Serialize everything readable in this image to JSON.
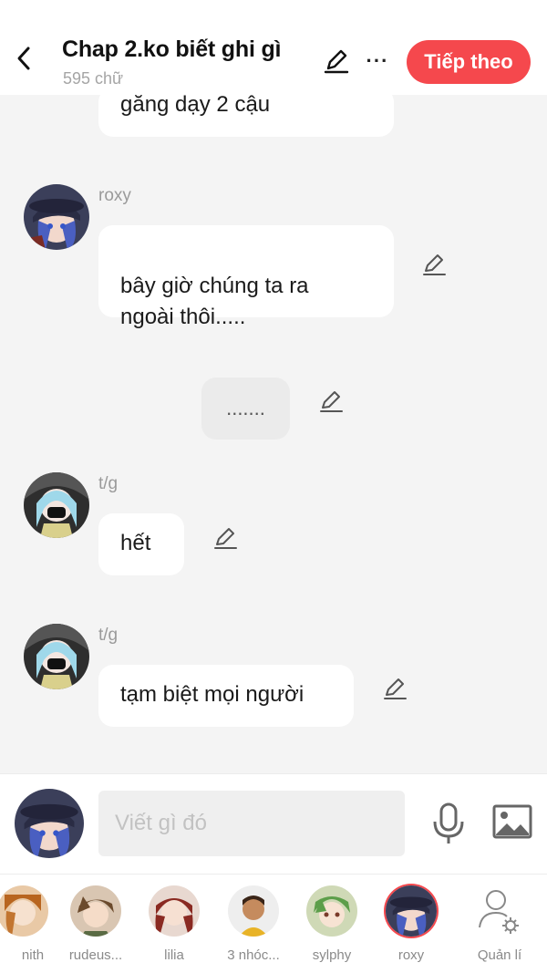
{
  "header": {
    "title": "Chap 2.ko biết ghi gì",
    "word_count": "595 chữ",
    "next_label": "Tiếp theo",
    "more_label": "···"
  },
  "messages": [
    {
      "type": "bubble",
      "text": "gắng dạy 2 cậu"
    },
    {
      "type": "character",
      "name": "roxy",
      "text": "bây giờ chúng ta ra\nngoài thôi....."
    },
    {
      "type": "narration",
      "text": "......."
    },
    {
      "type": "character",
      "name": "t/g",
      "text": "hết"
    },
    {
      "type": "character",
      "name": "t/g",
      "text": "tạm biệt mọi người"
    }
  ],
  "input": {
    "placeholder": "Viết gì đó"
  },
  "characters": [
    {
      "name": "nith"
    },
    {
      "name": "rudeus..."
    },
    {
      "name": "lilia"
    },
    {
      "name": "3 nhóc..."
    },
    {
      "name": "sylphy"
    },
    {
      "name": "roxy",
      "selected": true
    }
  ],
  "manage_label": "Quản lí",
  "colors": {
    "accent": "#f5484d",
    "background": "#f4f4f4",
    "bubble": "#ffffff"
  }
}
